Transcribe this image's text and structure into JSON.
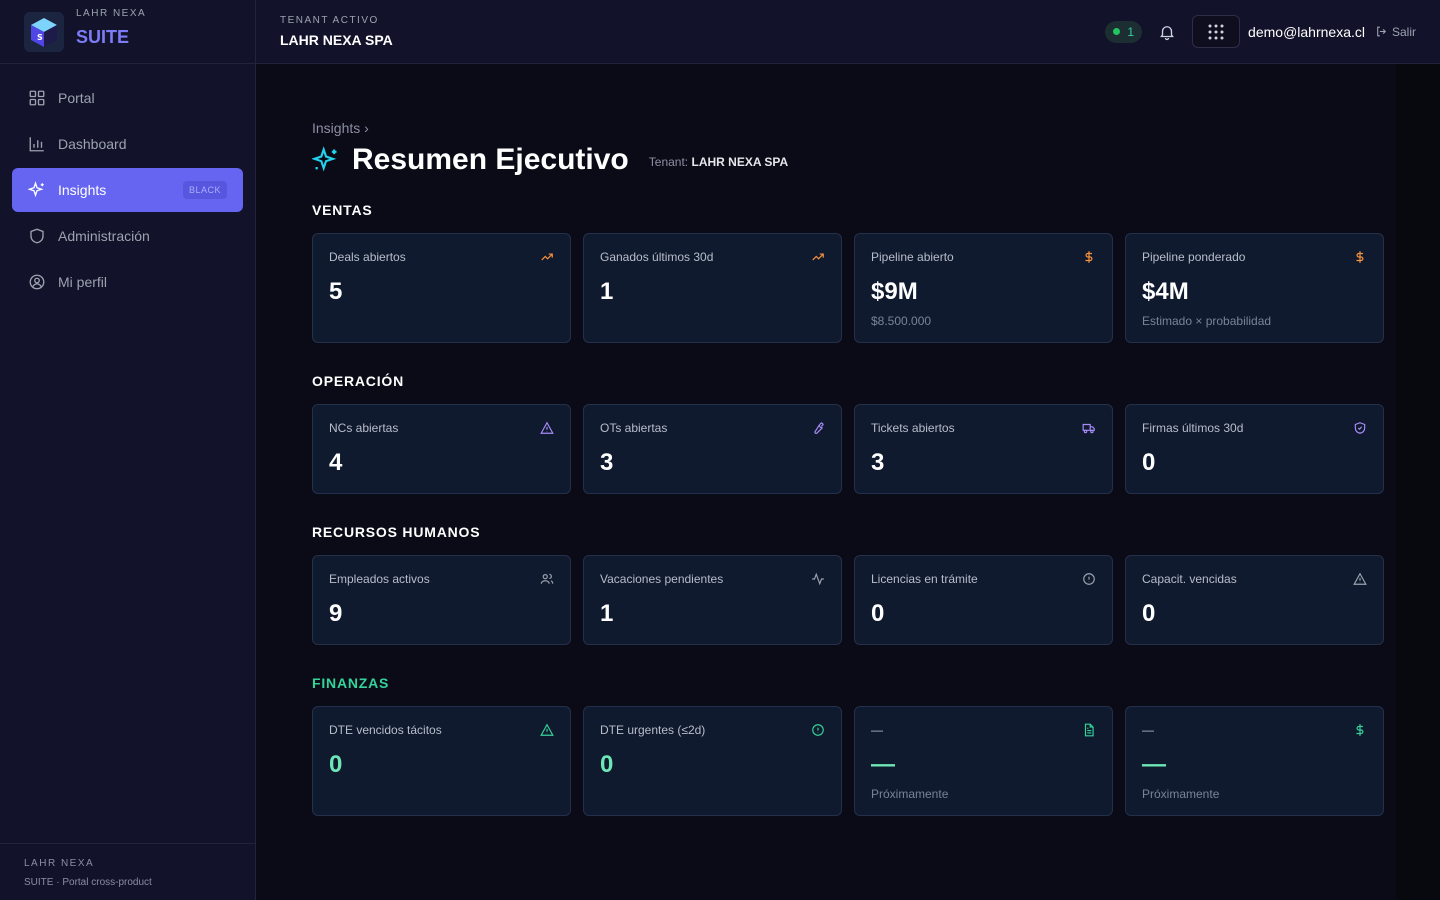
{
  "brand": {
    "top": "LAHR NEXA",
    "name": "SUITE"
  },
  "sidebar": {
    "items": [
      {
        "label": "Portal",
        "icon": "grid-icon"
      },
      {
        "label": "Dashboard",
        "icon": "bar-chart-icon"
      },
      {
        "label": "Insights",
        "icon": "sparkles-icon",
        "badge": "BLACK",
        "active": true
      },
      {
        "label": "Administración",
        "icon": "shield-icon"
      },
      {
        "label": "Mi perfil",
        "icon": "user-circle-icon"
      }
    ],
    "footer": {
      "line1": "LAHR NEXA",
      "line2": "SUITE · Portal cross-product"
    }
  },
  "header": {
    "tenant_label": "TENANT ACTIVO",
    "tenant_name": "LAHR NEXA SPA",
    "status_count": "1",
    "user_email": "demo@lahrnexa.cl",
    "logout_label": "Salir"
  },
  "page": {
    "breadcrumb": "Insights ›",
    "title": "Resumen Ejecutivo",
    "tenant_prefix": "Tenant:",
    "tenant_value": "LAHR NEXA SPA"
  },
  "sections": {
    "ventas": {
      "title": "VENTAS",
      "cards": [
        {
          "label": "Deals abiertos",
          "value": "5",
          "icon": "trending-up-icon"
        },
        {
          "label": "Ganados últimos 30d",
          "value": "1",
          "icon": "trending-up-icon"
        },
        {
          "label": "Pipeline abierto",
          "value": "$9M",
          "sub": "$8.500.000",
          "icon": "dollar-icon"
        },
        {
          "label": "Pipeline ponderado",
          "value": "$4M",
          "sub": "Estimado × probabilidad",
          "icon": "dollar-icon"
        }
      ]
    },
    "operacion": {
      "title": "OPERACIÓN",
      "cards": [
        {
          "label": "NCs abiertas",
          "value": "4",
          "icon": "alert-triangle-icon"
        },
        {
          "label": "OTs abiertas",
          "value": "3",
          "icon": "wrench-icon"
        },
        {
          "label": "Tickets abiertos",
          "value": "3",
          "icon": "truck-icon"
        },
        {
          "label": "Firmas últimos 30d",
          "value": "0",
          "icon": "shield-check-icon"
        }
      ]
    },
    "rrhh": {
      "title": "RECURSOS HUMANOS",
      "cards": [
        {
          "label": "Empleados activos",
          "value": "9",
          "icon": "users-icon"
        },
        {
          "label": "Vacaciones pendientes",
          "value": "1",
          "icon": "activity-icon"
        },
        {
          "label": "Licencias en trámite",
          "value": "0",
          "icon": "alert-circle-icon"
        },
        {
          "label": "Capacit. vencidas",
          "value": "0",
          "icon": "alert-triangle-icon"
        }
      ]
    },
    "finanzas": {
      "title": "FINANZAS",
      "cards": [
        {
          "label": "DTE vencidos tácitos",
          "value": "0",
          "icon": "alert-triangle-icon"
        },
        {
          "label": "DTE urgentes (≤2d)",
          "value": "0",
          "icon": "alert-circle-icon"
        },
        {
          "label": "—",
          "value": "—",
          "sub": "Próximamente",
          "icon": "file-text-icon"
        },
        {
          "label": "—",
          "value": "—",
          "sub": "Próximamente",
          "icon": "dollar-icon"
        }
      ]
    }
  },
  "colors": {
    "accent": "#6565f1",
    "orange_icon": "#fb923c",
    "purple_icon": "#a78bfa",
    "gray_icon": "#9ca3af",
    "green": "#34d399",
    "cyan": "#22d3ee"
  }
}
